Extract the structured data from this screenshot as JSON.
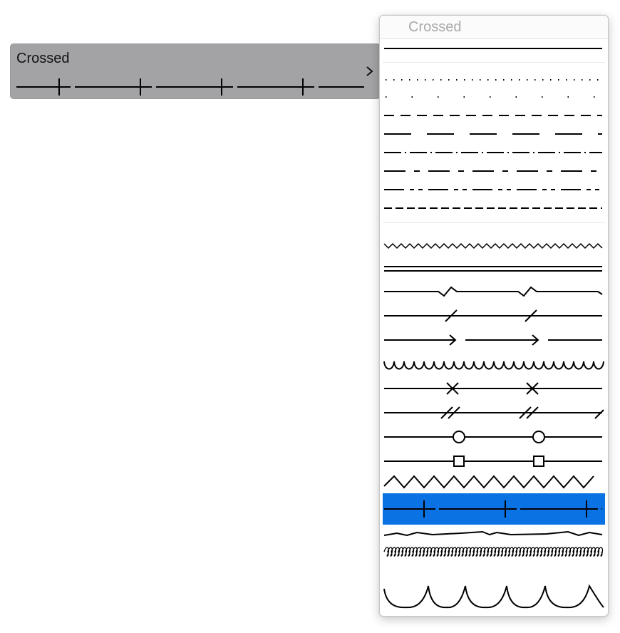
{
  "button": {
    "label": "Crossed",
    "chevron_icon": "chevron-right-icon"
  },
  "popup": {
    "title": "Crossed",
    "selected_style": "crossed",
    "selection_color": "#0b72e3",
    "groups": [
      [
        "solid"
      ],
      [
        "dotted",
        "sparse-dotted",
        "dashed",
        "long-dashed",
        "dash-dot",
        "dash-dot-long",
        "dash-dot-dot",
        "short-dashed"
      ],
      [
        "zigzag-small",
        "double",
        "break",
        "slash",
        "arrow",
        "wave",
        "x-marks",
        "double-slash",
        "circles",
        "squares",
        "zigzag-large",
        "crossed",
        "rough",
        "coil",
        "scallop"
      ]
    ]
  }
}
